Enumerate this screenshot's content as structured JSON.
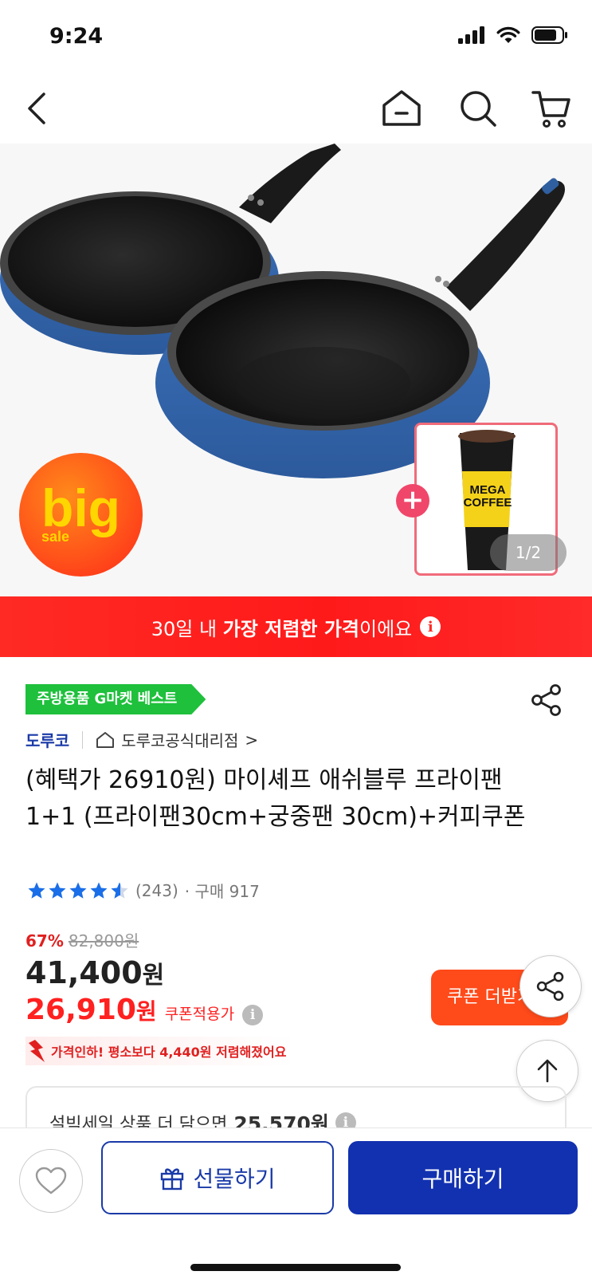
{
  "status_bar": {
    "time": "9:24"
  },
  "hero": {
    "badge_big": "big",
    "badge_sale": "sale",
    "coffee_brand": "MEGA COFFEE",
    "pager": "1/2"
  },
  "banner": {
    "prefix": "30일 내 ",
    "highlight": "가장 저렴한 가격",
    "suffix": "이에요"
  },
  "product": {
    "best_tag": "주방용품 G마켓 베스트",
    "brand": "도루코",
    "store": "도루코공식대리점",
    "store_arrow": ">",
    "title": "(혜택가 26910원) 마이셰프 애쉬블루 프라이팬 1+1 (프라이팬30cm+궁중팬 30cm)+커피쿠폰",
    "rating_count": "(243)",
    "purchase": "· 구매 917",
    "rating": 4.5,
    "discount": "67%",
    "original_price": "82,800원",
    "price_value": "41,400",
    "price_unit": "원",
    "coupon_price_value": "26,910",
    "coupon_price_unit": "원",
    "coupon_label": "쿠폰적용가",
    "price_drop_note": "가격인하! 평소보다 4,440원 저렴해졌어요",
    "coupon_button": "쿠폰 더받기",
    "bundle_text_prefix": "설빅세일 상품 더 담으면",
    "bundle_amount": "25,570원"
  },
  "bottom_bar": {
    "gift_label": "선물하기",
    "buy_label": "구매하기"
  },
  "colors": {
    "brand_blue": "#1231b0",
    "banner_red": "#ff2a24",
    "best_green": "#1fc03c",
    "coupon_orange": "#ff4a1a"
  }
}
